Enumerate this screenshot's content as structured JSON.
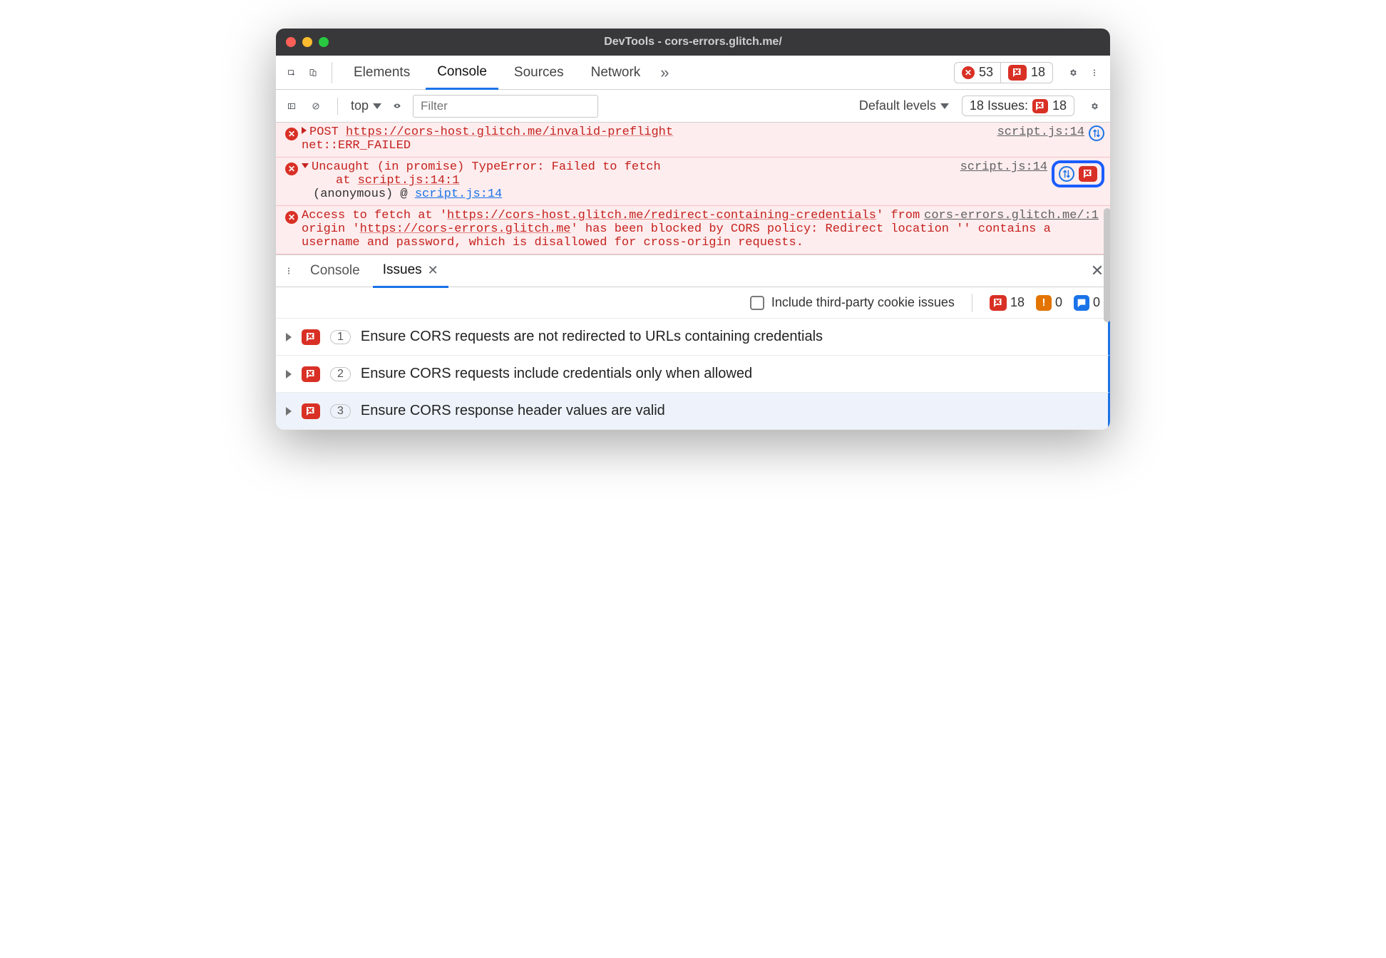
{
  "window": {
    "title": "DevTools - cors-errors.glitch.me/"
  },
  "tabs": {
    "elements": "Elements",
    "console": "Console",
    "sources": "Sources",
    "network": "Network"
  },
  "toolbar1": {
    "error_count": "53",
    "issue_count": "18"
  },
  "toolbar2": {
    "context": "top",
    "filter_placeholder": "Filter",
    "levels": "Default levels",
    "issues_label": "18 Issues:",
    "issues_count": "18"
  },
  "console": {
    "row1": {
      "method": "POST",
      "url": "https://cors-host.glitch.me/invalid-preflight",
      "err": "net::ERR_FAILED",
      "src": "script.js:14"
    },
    "row2": {
      "line1": "Uncaught (in promise) TypeError: Failed to fetch",
      "line2_pre": "at ",
      "line2_link": "script.js:14:1",
      "anon_label": "(anonymous)",
      "at": "@",
      "anon_link": "script.js:14",
      "src": "script.js:14"
    },
    "row3": {
      "t1": "Access to fetch at '",
      "url1": "https://cors-host.glitch.me/redirect-containing-credentials",
      "t2": "' from origin '",
      "url2": "https://cors-errors.glitch.me",
      "t3": "' has been blocked by CORS policy: Redirect location '' contains a username and password, which is disallowed for cross-origin requests.",
      "src": "cors-errors.glitch.me/:1"
    }
  },
  "drawer": {
    "console": "Console",
    "issues": "Issues"
  },
  "issues_bar": {
    "checkbox_label": "Include third-party cookie issues",
    "errors": "18",
    "warnings": "0",
    "info": "0"
  },
  "issues": [
    {
      "count": "1",
      "title": "Ensure CORS requests are not redirected to URLs containing credentials"
    },
    {
      "count": "2",
      "title": "Ensure CORS requests include credentials only when allowed"
    },
    {
      "count": "3",
      "title": "Ensure CORS response header values are valid"
    }
  ]
}
